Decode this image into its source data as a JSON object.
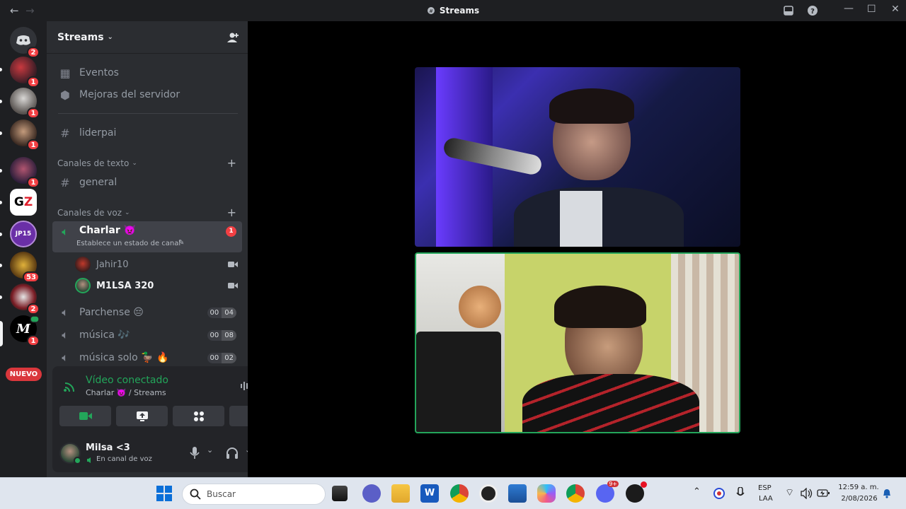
{
  "window": {
    "title": "Streams",
    "back_icon": "arrow-left-icon",
    "forward_icon": "arrow-right-icon"
  },
  "servers": [
    {
      "badge": "2"
    },
    {
      "badge": "1"
    },
    {
      "badge": "1"
    },
    {
      "badge": "1"
    },
    {
      "badge": "1"
    },
    {
      "badge": ""
    },
    {
      "badge": ""
    },
    {
      "badge": "53"
    },
    {
      "badge": "2"
    },
    {
      "badge": "1"
    }
  ],
  "rail": {
    "new_label": "NUEVO"
  },
  "sidebar": {
    "server_name": "Streams",
    "events": "Eventos",
    "boosts": "Mejoras del servidor",
    "liderpai": "liderpai",
    "text_category": "Canales de texto",
    "general": "general",
    "voice_category": "Canales de voz",
    "charlar": "Charlar 👿",
    "charlar_badge": "1",
    "charlar_status": "Establece un estado de canal",
    "users": [
      {
        "name": "Jahir10"
      },
      {
        "name": "M1LSA 320"
      }
    ],
    "parchense": "Parchense 😔",
    "parchense_count": [
      "00",
      "04"
    ],
    "musica": "música 🎶",
    "musica_count": [
      "00",
      "08"
    ],
    "musica_solo": "música solo 🦆 🔥",
    "musica_solo_count": [
      "00",
      "02"
    ]
  },
  "voice": {
    "status": "Vídeo conectado",
    "channel": "Charlar 👿 / Streams"
  },
  "user": {
    "name": "Milsa <3",
    "status": "En canal de voz"
  },
  "taskbar": {
    "search_placeholder": "Buscar",
    "lang_top": "ESP",
    "lang_bottom": "LAA",
    "time": "12:59 a. m.",
    "date": "2/08/2026",
    "discord_badge": "9+"
  }
}
